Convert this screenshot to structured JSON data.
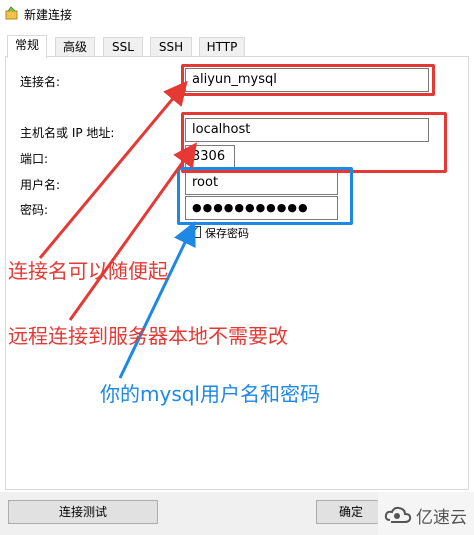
{
  "window": {
    "title": "新建连接",
    "icon": "navicat-connection-icon"
  },
  "tabs": [
    {
      "label": "常规",
      "active": true
    },
    {
      "label": "高级",
      "active": false
    },
    {
      "label": "SSL",
      "active": false
    },
    {
      "label": "SSH",
      "active": false
    },
    {
      "label": "HTTP",
      "active": false
    }
  ],
  "form": {
    "connection_name_label": "连接名:",
    "connection_name_value": "aliyun_mysql",
    "host_label": "主机名或 IP 地址:",
    "host_value": "localhost",
    "port_label": "端口:",
    "port_value": "3306",
    "username_label": "用户名:",
    "username_value": "root",
    "password_label": "密码:",
    "password_value": "●●●●●●●●●●●",
    "remember_password_label": "保存密码",
    "remember_password_checked": true
  },
  "annotations": {
    "connection_name_note": "连接名可以随便起",
    "remote_note": "远程连接到服务器本地不需要改",
    "credentials_note": "你的mysql用户名和密码",
    "red_color": "#e53935",
    "blue_color": "#1e88e5"
  },
  "buttons": {
    "test_connection": "连接测试",
    "ok": "确定"
  },
  "watermark": {
    "text": "亿速云"
  }
}
